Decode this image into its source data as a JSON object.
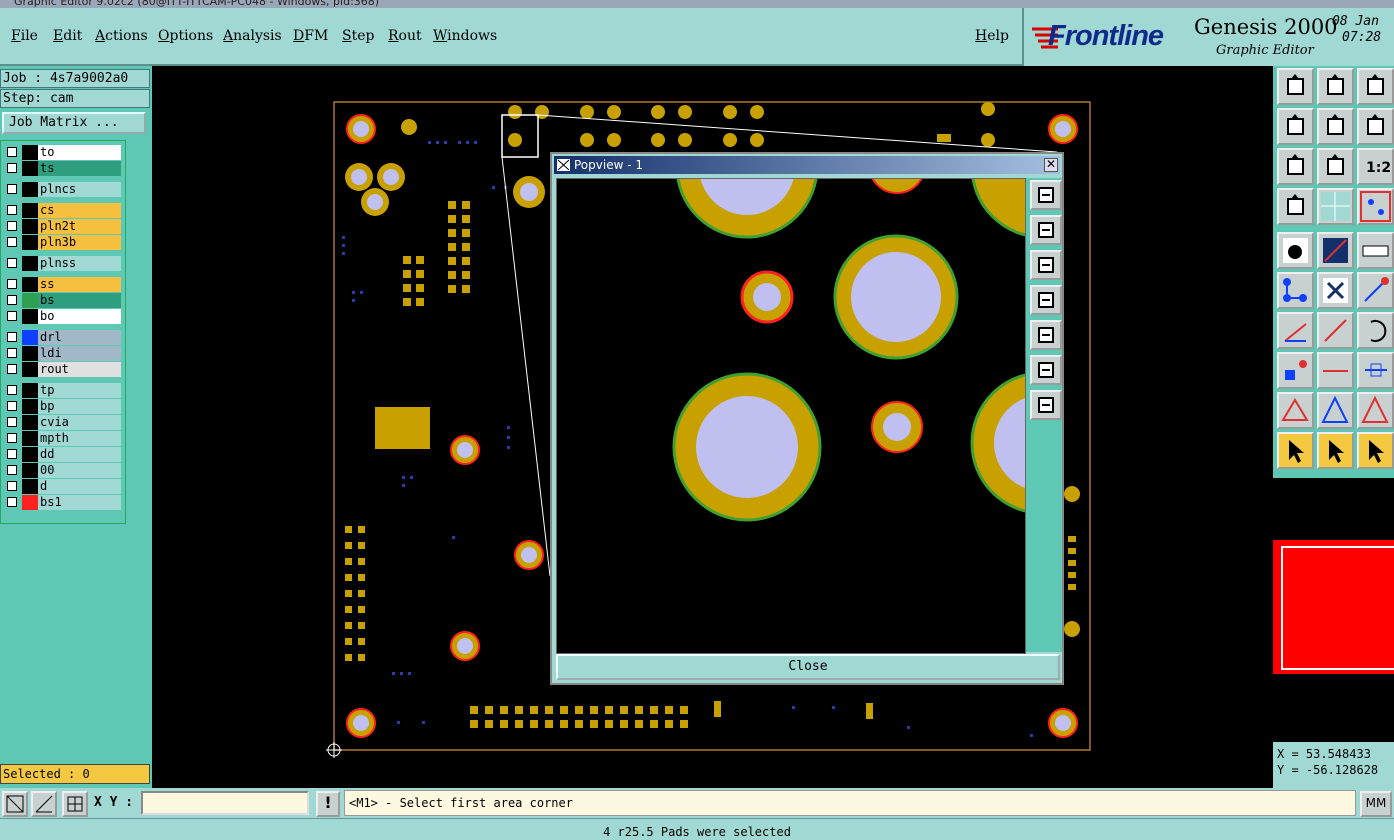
{
  "window": {
    "title": "Graphic Editor 9.02c2 (80@ITT-ITTCAM-PC048 - Windows, pid:368)"
  },
  "menu": [
    "File",
    "Edit",
    "Actions",
    "Options",
    "Analysis",
    "DFM",
    "Step",
    "Rout",
    "Windows"
  ],
  "help_label": "Help",
  "brand": {
    "logo": "Frontline",
    "product": "Genesis 2000",
    "subtitle": "Graphic Editor",
    "date": "08 Jan",
    "time": "07:28"
  },
  "job": {
    "job_line": "Job : 4s7a9002a0",
    "step_line": "Step: cam",
    "matrix_button": "Job Matrix ..."
  },
  "layers": [
    {
      "name": "to",
      "color": "#ffffff",
      "swatch": "#000000"
    },
    {
      "name": "ts",
      "color": "#2e9e7e",
      "swatch": "#000000"
    },
    {
      "name": "plncs",
      "color": "#a0d8d4",
      "swatch": "#000000"
    },
    {
      "name": "cs",
      "color": "#f5c040",
      "swatch": "#000000"
    },
    {
      "name": "pln2t",
      "color": "#f5c040",
      "swatch": "#000000"
    },
    {
      "name": "pln3b",
      "color": "#f5c040",
      "swatch": "#000000"
    },
    {
      "name": "plnss",
      "color": "#a0d8d4",
      "swatch": "#000000"
    },
    {
      "name": "ss",
      "color": "#f5c040",
      "swatch": "#000000"
    },
    {
      "name": "bs",
      "color": "#2e9e7e",
      "swatch": "#2ea050"
    },
    {
      "name": "bo",
      "color": "#ffffff",
      "swatch": "#000000"
    },
    {
      "name": "drl",
      "color": "#a0b8c8",
      "swatch": "#1040ff"
    },
    {
      "name": "ldi",
      "color": "#a0b8c8",
      "swatch": "#000000"
    },
    {
      "name": "rout",
      "color": "#e0e0e0",
      "swatch": "#000000"
    },
    {
      "name": "tp",
      "color": "#a0d8d4",
      "swatch": "#000000"
    },
    {
      "name": "bp",
      "color": "#a0d8d4",
      "swatch": "#000000"
    },
    {
      "name": "cvia",
      "color": "#a0d8d4",
      "swatch": "#000000"
    },
    {
      "name": "mpth",
      "color": "#a0d8d4",
      "swatch": "#000000"
    },
    {
      "name": "dd",
      "color": "#a0d8d4",
      "swatch": "#000000"
    },
    {
      "name": "00",
      "color": "#a0d8d4",
      "swatch": "#000000"
    },
    {
      "name": "d",
      "color": "#a0d8d4",
      "swatch": "#000000"
    },
    {
      "name": "bs1",
      "color": "#a0d8d4",
      "swatch": "#ff2020"
    }
  ],
  "selected_label": "Selected : 0",
  "coords": {
    "x": "X = 53.548433",
    "y": "Y = -56.128628"
  },
  "xy_label": "X Y :",
  "xy_input": "",
  "prompt": "<M1> - Select first area corner",
  "units_button": "MM",
  "status": "4 r25.5 Pads were selected",
  "popview": {
    "title": "Popview - 1",
    "close_label": "Close"
  },
  "colors": {
    "panel": "#a0d8d4",
    "accent": "#5fc8b4",
    "pad_gold": "#c8a000",
    "hole": "#c0c0f0",
    "highlight_red": "#ff2020",
    "outline_green": "#40a030"
  }
}
